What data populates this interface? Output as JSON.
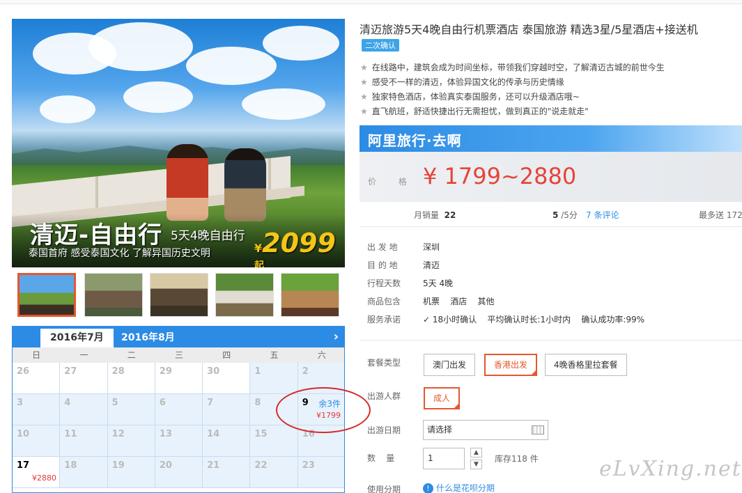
{
  "hero": {
    "title": "清迈-自由行",
    "subtitle": "5天4晚自由行",
    "tagline": "泰国首府 感受泰国文化 了解异国历史文明",
    "price_currency": "¥",
    "price_value": "2099",
    "price_suffix": "起"
  },
  "calendar": {
    "tabs": [
      "2016年7月",
      "2016年8月"
    ],
    "next_icon": "chevron-right-icon",
    "weekdays": [
      "日",
      "一",
      "二",
      "三",
      "四",
      "五",
      "六"
    ],
    "rows": [
      [
        {
          "d": "26"
        },
        {
          "d": "27"
        },
        {
          "d": "28"
        },
        {
          "d": "29"
        },
        {
          "d": "30"
        },
        {
          "d": "1"
        },
        {
          "d": "2"
        }
      ],
      [
        {
          "d": "3"
        },
        {
          "d": "4"
        },
        {
          "d": "5"
        },
        {
          "d": "6"
        },
        {
          "d": "7"
        },
        {
          "d": "8"
        },
        {
          "d": "9",
          "stock": "余3件",
          "price": "¥1799"
        }
      ],
      [
        {
          "d": "10"
        },
        {
          "d": "11"
        },
        {
          "d": "12"
        },
        {
          "d": "13"
        },
        {
          "d": "14"
        },
        {
          "d": "15"
        },
        {
          "d": "16"
        }
      ],
      [
        {
          "d": "17",
          "price": "¥2880"
        },
        {
          "d": "18"
        },
        {
          "d": "19"
        },
        {
          "d": "20"
        },
        {
          "d": "21"
        },
        {
          "d": "22"
        },
        {
          "d": "23"
        }
      ]
    ]
  },
  "product": {
    "title": "清迈旅游5天4晚自由行机票酒店 泰国旅游 精选3星/5星酒店+接送机",
    "badge": "二次确认",
    "features": [
      "在线路中，建筑会成为时间坐标，带领我们穿越时空，了解清迈古城的前世今生",
      "感受不一样的清迈，体验异国文化的传承与历史情缘",
      "独家特色酒店，体验真实泰国服务，还可以升级酒店哦~",
      "直飞航班，舒适快捷出行无需担忧，做到真正的\"说走就走\""
    ],
    "brand": "阿里旅行·去啊",
    "price_label": "价 格",
    "price": "¥ 1799~2880"
  },
  "stats": {
    "monthly_label": "月销量",
    "monthly_value": "22",
    "score": "5",
    "score_suffix": "/5分",
    "reviews": "7 条评论",
    "points": "最多送 172"
  },
  "info": [
    {
      "label": "出 发 地",
      "value": "深圳"
    },
    {
      "label": "目 的 地",
      "value": "清迈"
    },
    {
      "label": "行程天数",
      "value": "5天 4晚"
    },
    {
      "label": "商品包含",
      "value": "机票    酒店    其他"
    },
    {
      "label": "服务承诺",
      "value": "18小时确认    平均确认时长:1小时内    确认成功率:99%"
    }
  ],
  "form": {
    "package_label": "套餐类型",
    "packages": [
      "澳门出发",
      "香港出发",
      "4晚香格里拉套餐"
    ],
    "traveler_label": "出游人群",
    "traveler": "成人",
    "date_label": "出游日期",
    "date_placeholder": "请选择",
    "qty_label": "数    量",
    "qty_value": "1",
    "stock": "库存118 件",
    "installment_label": "使用分期",
    "installment_link": "什么是花呗分期"
  },
  "watermark": "eLvXing.net",
  "colors": {
    "accent": "#2c8be4",
    "price": "#e5443a",
    "selected": "#e4572e"
  }
}
